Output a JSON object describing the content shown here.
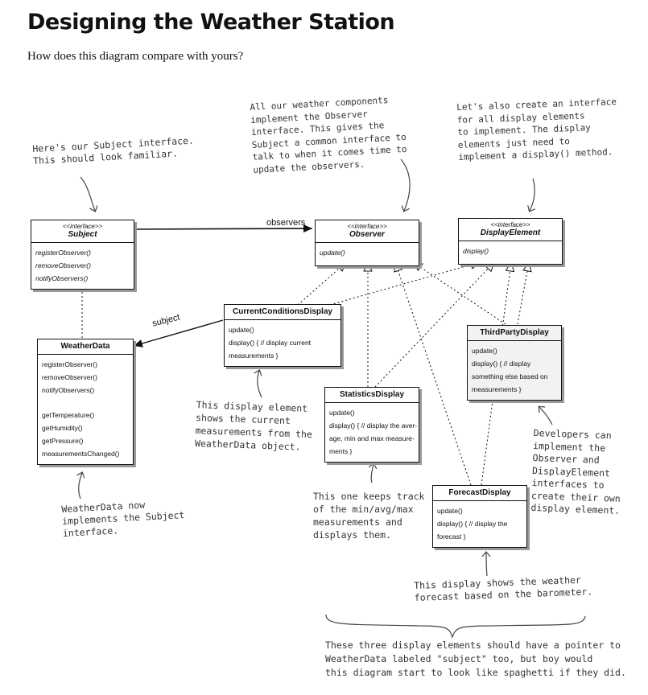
{
  "page": {
    "title": "Designing the Weather Station",
    "subtitle": "How does this diagram compare with yours?"
  },
  "boxes": {
    "subject": {
      "stereotype": "<<interface>>",
      "name": "Subject",
      "methods": [
        "registerObserver()",
        "removeObserver()",
        "notifyObservers()"
      ]
    },
    "observer": {
      "stereotype": "<<interface>>",
      "name": "Observer",
      "methods": [
        "update()"
      ]
    },
    "display_element": {
      "stereotype": "<<interface>>",
      "name": "DisplayElement",
      "methods": [
        "display()"
      ]
    },
    "weather_data": {
      "name": "WeatherData",
      "methods": [
        "registerObserver()",
        "removeObserver()",
        "notifyObservers()",
        "getTemperature()",
        "getHumidity()",
        "getPressure()",
        "measurementsChanged()"
      ]
    },
    "current_conditions": {
      "name": "CurrentConditionsDisplay",
      "lines": [
        "update()",
        "display() { // display current",
        "measurements }"
      ]
    },
    "statistics": {
      "name": "StatisticsDisplay",
      "lines": [
        "update()",
        "display() { // display the aver-",
        "age, min and max measure-",
        "ments }"
      ]
    },
    "third_party": {
      "name": "ThirdPartyDisplay",
      "lines": [
        "update()",
        "display() { // display",
        "something else based on",
        "measurements }"
      ]
    },
    "forecast": {
      "name": "ForecastDisplay",
      "lines": [
        "update()",
        "display() { // display the",
        "forecast }"
      ]
    }
  },
  "labels": {
    "observers": "observers",
    "subject": "subject"
  },
  "notes": {
    "subject_note": "Here's our Subject interface.\nThis should look familiar.",
    "observer_note": "All our weather components\nimplement the Observer\ninterface. This gives the\nSubject a common interface to\ntalk to when it comes time to\nupdate the observers.",
    "display_note": "Let's also create an interface\nfor all display elements\nto implement. The display\nelements just need to\nimplement a display() method.",
    "current_note": "This display element\nshows the current\nmeasurements from the\nWeatherData object.",
    "weatherdata_note": "WeatherData now\nimplements the Subject\ninterface.",
    "statistics_note": "This one keeps track\nof the min/avg/max\nmeasurements and\ndisplays them.",
    "developers_note": "Developers can\nimplement the\nObserver and\nDisplayElement\ninterfaces to\ncreate their own\ndisplay element.",
    "forecast_note": "This display shows the weather\nforecast based on the barometer.",
    "spaghetti_note": "These three display elements should have a pointer to\nWeatherData labeled \"subject\" too, but boy would\nthis diagram start to look like spaghetti if they did."
  }
}
